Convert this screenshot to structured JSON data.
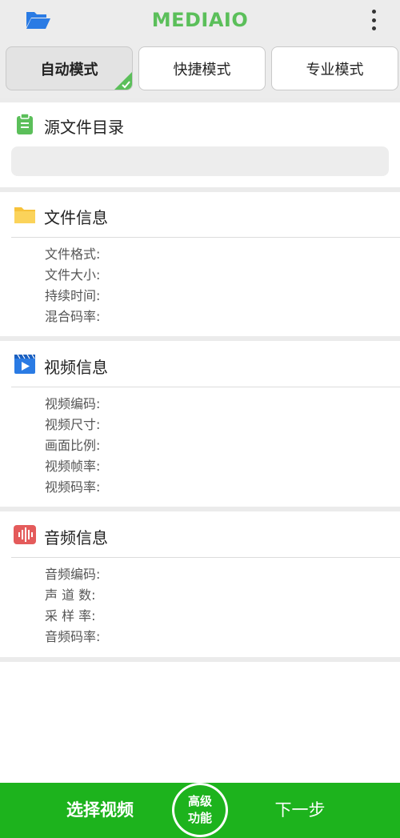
{
  "app": {
    "title": "MEDIAIO"
  },
  "icons": {
    "folder": "open-folder-icon",
    "more": "more-vertical-icon",
    "source": "clipboard-icon",
    "file": "folder-icon",
    "video": "video-play-icon",
    "audio": "audio-wave-icon"
  },
  "colors": {
    "brand_green": "#5bbf5a",
    "bottom_bar": "#1db31d",
    "folder_blue": "#2a7be4",
    "file_yellow": "#f7c23a",
    "video_blue": "#2a7be4",
    "audio_red": "#e45b5b"
  },
  "tabs": [
    {
      "label": "自动模式",
      "active": true
    },
    {
      "label": "快捷模式",
      "active": false
    },
    {
      "label": "专业模式",
      "active": false
    }
  ],
  "source": {
    "title": "源文件目录",
    "path": ""
  },
  "file_info": {
    "title": "文件信息",
    "fields": [
      "文件格式:",
      "文件大小:",
      "持续时间:",
      "混合码率:"
    ]
  },
  "video_info": {
    "title": "视频信息",
    "fields": [
      "视频编码:",
      "视频尺寸:",
      "画面比例:",
      "视频帧率:",
      "视频码率:"
    ]
  },
  "audio_info": {
    "title": "音频信息",
    "fields": [
      "音频编码:",
      "声 道 数:",
      "采 样 率:",
      "音频码率:"
    ]
  },
  "bottom": {
    "select_video": "选择视频",
    "advanced_line1": "高级",
    "advanced_line2": "功能",
    "next_step": "下一步"
  }
}
